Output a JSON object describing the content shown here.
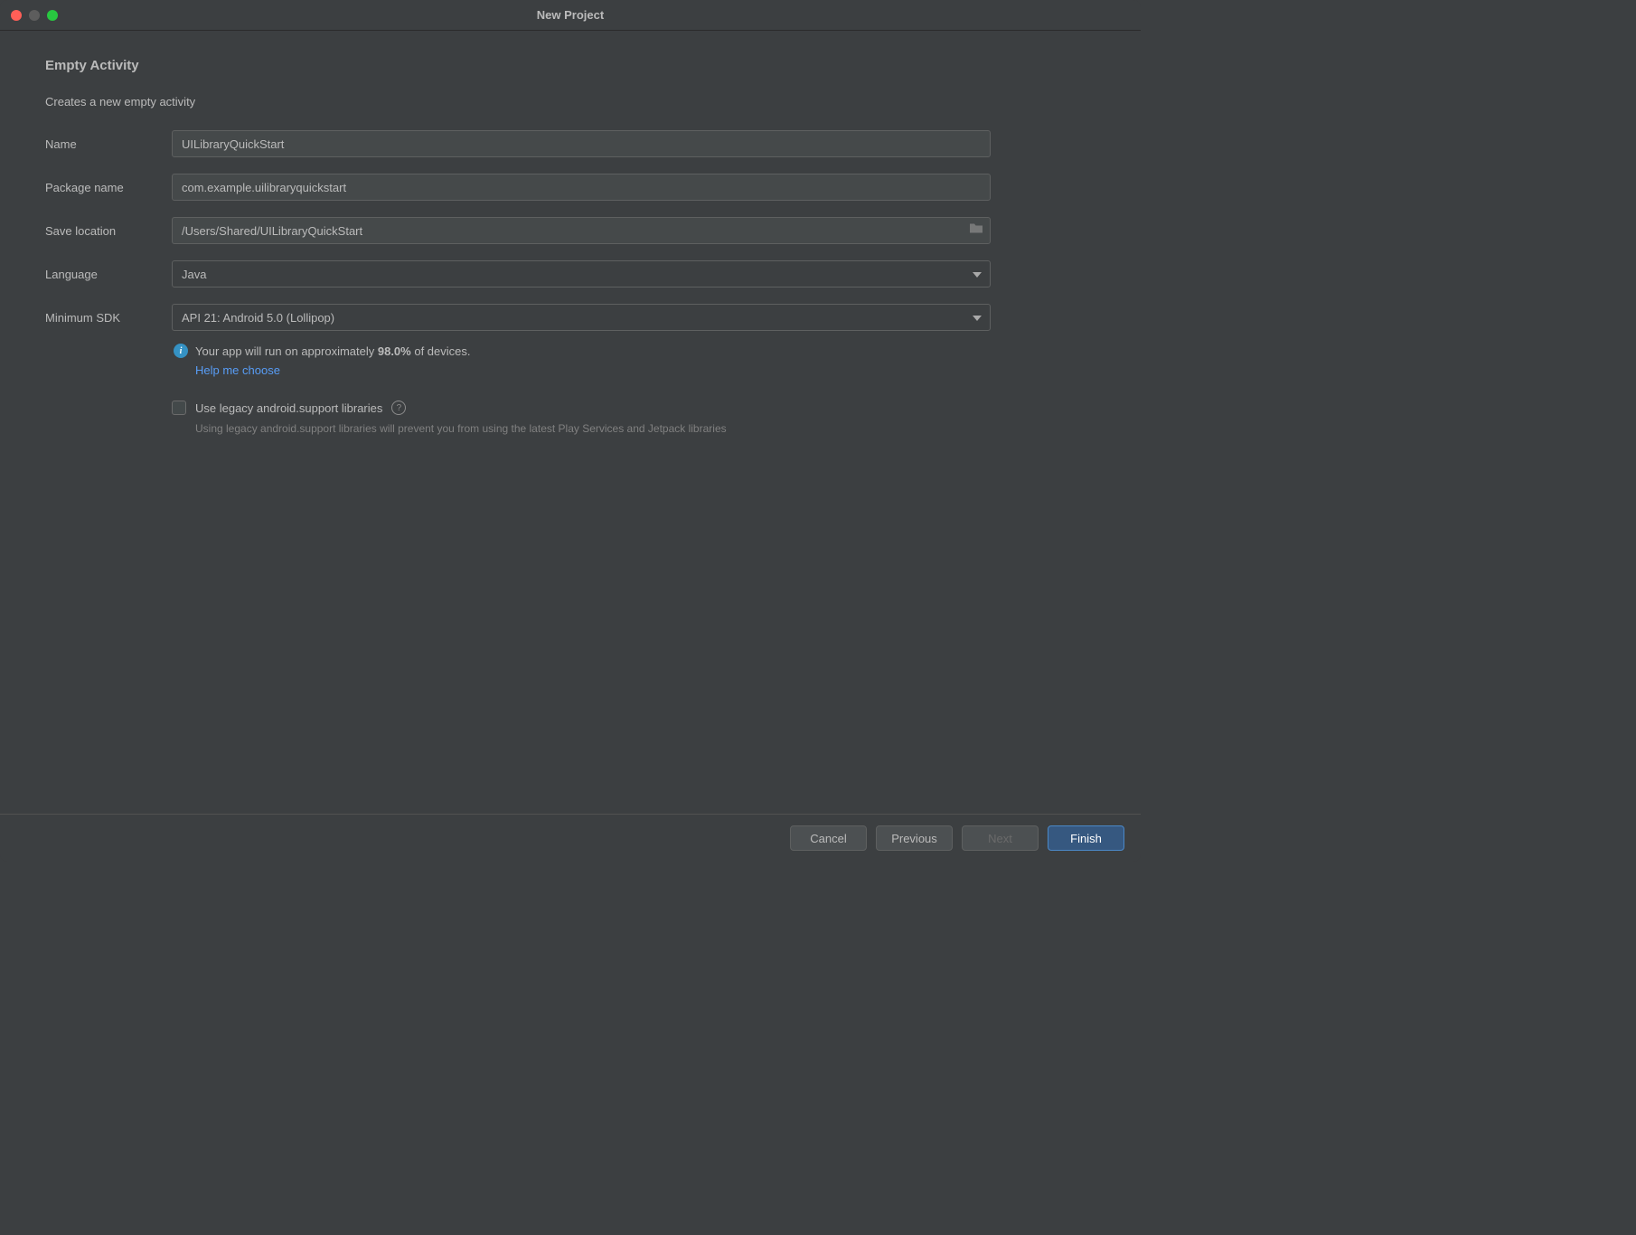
{
  "window": {
    "title": "New Project"
  },
  "page": {
    "heading": "Empty Activity",
    "subheading": "Creates a new empty activity"
  },
  "form": {
    "name": {
      "label": "Name",
      "value": "UILibraryQuickStart"
    },
    "package": {
      "label": "Package name",
      "value": "com.example.uilibraryquickstart"
    },
    "save_location": {
      "label": "Save location",
      "value": "/Users/Shared/UILibraryQuickStart"
    },
    "language": {
      "label": "Language",
      "value": "Java"
    },
    "min_sdk": {
      "label": "Minimum SDK",
      "value": "API 21: Android 5.0 (Lollipop)"
    }
  },
  "info": {
    "prefix": "Your app will run on approximately ",
    "percent": "98.0%",
    "suffix": " of devices.",
    "help_link": "Help me choose"
  },
  "legacy": {
    "label": "Use legacy android.support libraries",
    "hint": "Using legacy android.support libraries will prevent you from using the latest Play Services and Jetpack libraries"
  },
  "footer": {
    "cancel": "Cancel",
    "previous": "Previous",
    "next": "Next",
    "finish": "Finish"
  }
}
